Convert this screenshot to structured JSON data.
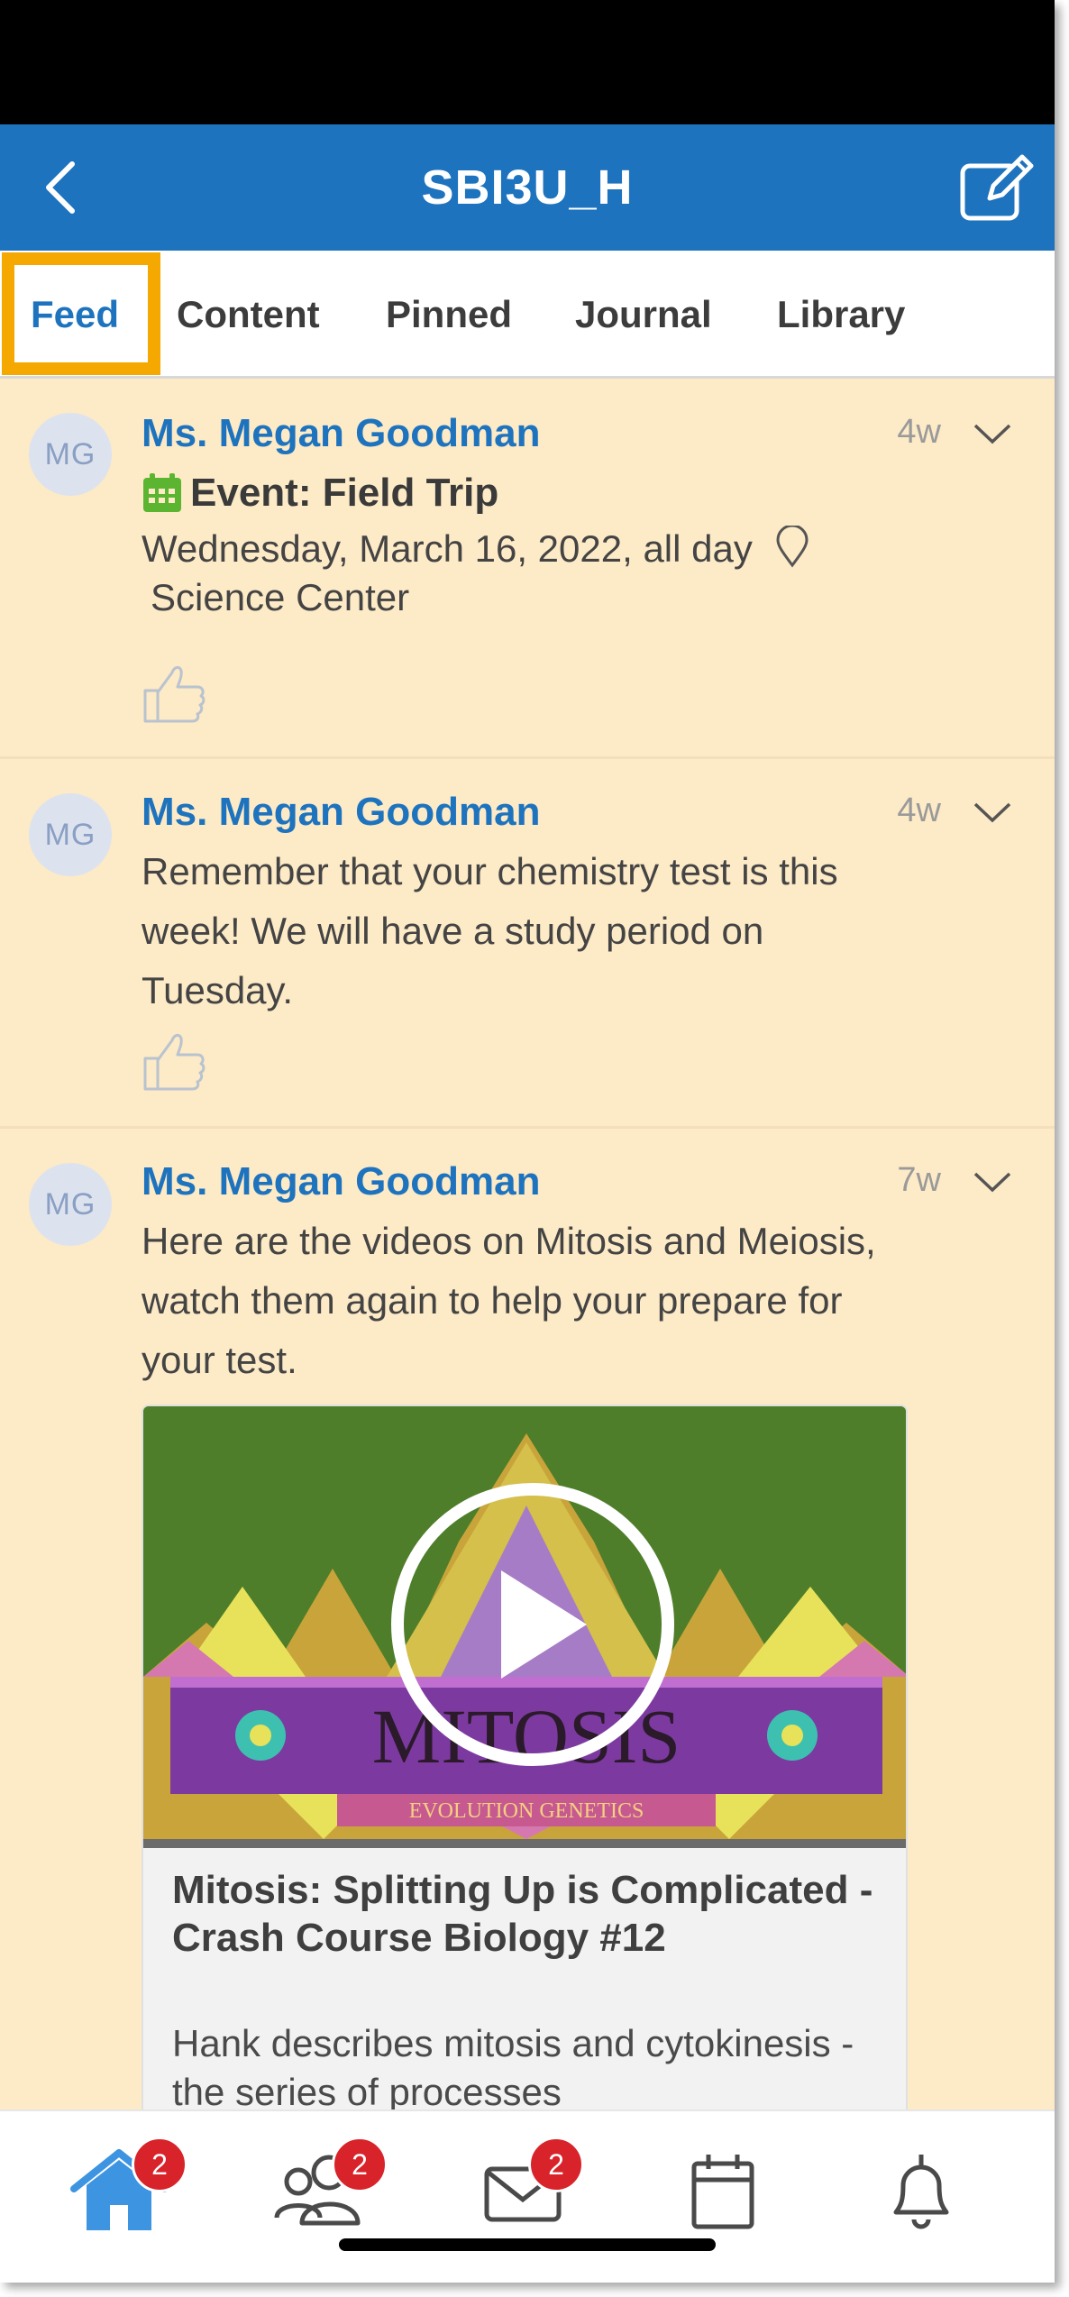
{
  "header": {
    "title": "SBI3U_H",
    "back_icon": "chevron-left-icon",
    "edit_icon": "compose-icon"
  },
  "tabs": [
    {
      "label": "Feed",
      "active": true
    },
    {
      "label": "Content",
      "active": false
    },
    {
      "label": "Pinned",
      "active": false
    },
    {
      "label": "Journal",
      "active": false
    },
    {
      "label": "Library",
      "active": false
    }
  ],
  "posts": [
    {
      "initials": "MG",
      "author": "Ms. Megan Goodman",
      "age": "4w",
      "event_label": "Event: Field Trip",
      "event_date": "Wednesday, March 16, 2022, all day",
      "event_location": "Science Center"
    },
    {
      "initials": "MG",
      "author": "Ms. Megan Goodman",
      "age": "4w",
      "text": "Remember that your chemistry test is this week! We will have a study period on Tuesday."
    },
    {
      "initials": "MG",
      "author": "Ms. Megan Goodman",
      "age": "7w",
      "text": "Here are the videos on Mitosis and Meiosis, watch them again to help your prepare for your test.",
      "video": {
        "thumb_title": "MITOSIS",
        "thumb_subtitle": "EVOLUTION GENETICS",
        "title": "Mitosis: Splitting Up is Complicated - Crash Course Biology #12",
        "description": "Hank describes mitosis and cytokinesis - the series of processes"
      }
    }
  ],
  "bottom_nav": {
    "items": [
      {
        "icon": "home-icon",
        "badge": "2",
        "active": true
      },
      {
        "icon": "people-icon",
        "badge": "2",
        "active": false
      },
      {
        "icon": "mail-icon",
        "badge": "2",
        "active": false
      },
      {
        "icon": "calendar-icon",
        "badge": "",
        "active": false
      },
      {
        "icon": "bell-icon",
        "badge": "",
        "active": false
      }
    ]
  },
  "colors": {
    "brand": "#1e73be",
    "feed_bg": "#fdeac6",
    "highlight": "#f5a800",
    "badge": "#d8232a"
  }
}
